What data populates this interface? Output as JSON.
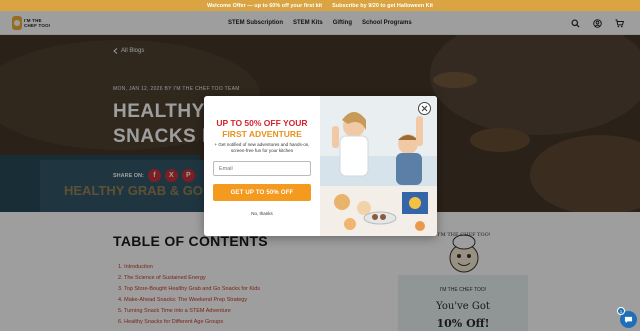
{
  "announcement": {
    "left_text": "Welcome Offer — up to 60% off your first kit",
    "right_text": "Subscribe by 9/20 to get Halloween Kit"
  },
  "header": {
    "logo_text_top": "I'M THE",
    "logo_text_mid": "CHEF TOO!",
    "nav": [
      "STEM Subscription",
      "STEM Kits",
      "Gifting",
      "School Programs"
    ],
    "icons": [
      "search-icon",
      "account-icon",
      "cart-icon"
    ]
  },
  "hero": {
    "back_label": "All Blogs",
    "meta": "MON, JAN 12, 2026 BY I'M THE CHEF TOO TEAM",
    "title_line1": "HEALTHY G",
    "title_line2": "SNACKS FO",
    "share_label": "SHARE ON:",
    "share_buttons": [
      "f",
      "X",
      "P"
    ],
    "background_banner_text": "HEALTHY GRAB & GO NACK"
  },
  "toc": {
    "title": "TABLE OF CONTENTS",
    "items": [
      "1. Introduction",
      "2. The Science of Sustained Energy",
      "3. Top Store-Bought Healthy Grab and Go Snacks for Kids",
      "4. Make-Ahead Snacks: The Weekend Prep Strategy",
      "5. Turning Snack Time into a STEM Adventure",
      "6. Healthy Snacks for Different Age Groups"
    ]
  },
  "sidebar_promo": {
    "logo_caption": "I'M THE CHEF TOO!",
    "brand": "I'M THE CHEF TOO!",
    "line1": "You've Got",
    "line2": "10% Off!"
  },
  "chat": {
    "badge": "1"
  },
  "modal": {
    "headline_1": "UP TO 50% OFF YOUR",
    "headline_2": "FIRST ADVENTURE",
    "subtext": "+ Get notified of new adventures and hands-on, screen-free fun for your kitchen",
    "email_placeholder": "Email",
    "cta_label": "GET UP TO 50% OFF",
    "decline_label": "No, thanks"
  },
  "colors": {
    "announce": "#d9a441",
    "accent_red": "#d3262c",
    "accent_orange": "#f39a1f",
    "link_red": "#c0392b"
  }
}
